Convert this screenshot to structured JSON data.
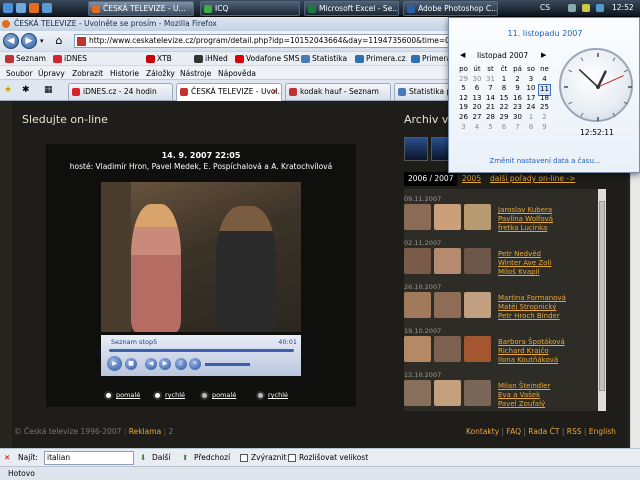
{
  "taskbar": {
    "buttons": [
      {
        "label": "ČESKÁ TELEVIZE - U...",
        "active": true
      },
      {
        "label": "ICQ",
        "active": false
      },
      {
        "label": "Microsoft Excel - Se...",
        "active": false
      },
      {
        "label": "Adobe Photoshop C...",
        "active": false
      }
    ],
    "language": "CS",
    "clock": "12:52"
  },
  "browser": {
    "window_title": "ČESKÁ TELEVIZE - Uvolněte se prosím - Mozilla Firefox",
    "url": "http://www.ceskatelevize.cz/program/detail.php?idp=10152043664&day=1194735600&time=01:50&ch=28",
    "bookmarks": [
      "Seznam",
      "iDNES",
      "XTB",
      "iHNed",
      "Vodafone SMS",
      "Statistika",
      "Primera.cz",
      "Primera"
    ],
    "menu": [
      "Soubor",
      "Úpravy",
      "Zobrazit",
      "Historie",
      "Záložky",
      "Nástroje",
      "Nápověda"
    ],
    "tabs": [
      {
        "label": "iDNES.cz - 24 hodin",
        "active": false
      },
      {
        "label": "ČESKÁ TELEVIZE - Uvol...",
        "active": true
      },
      {
        "label": "kodak hauf - Seznam",
        "active": false
      },
      {
        "label": "Statistika p",
        "active": false
      }
    ]
  },
  "page": {
    "live_title": "Sledujte on-line",
    "player": {
      "date": "14. 9. 2007 22:05",
      "guests": "hosté: Vladimír Hron, Pavel Medek, E. Pospíchalová a A. Kratochvílová",
      "media_title": "Seznam stop5",
      "media_time": "40:01",
      "quality_options": [
        {
          "label": "pomalé",
          "type": "wmp"
        },
        {
          "label": "rychlé",
          "type": "wmp"
        },
        {
          "label": "pomalé",
          "type": "real"
        },
        {
          "label": "rychlé",
          "type": "real"
        }
      ],
      "real_prefix": "real"
    },
    "archive": {
      "title": "Archiv v",
      "tabs": [
        "2006 / 2007",
        "2005",
        "další pořady on-line ->"
      ],
      "entries": [
        {
          "date": "09.11.2007",
          "names": [
            "Jaroslav Kubera",
            "Pavlína Wolfová",
            "fretka Lucinka"
          ]
        },
        {
          "date": "02.11.2007",
          "names": [
            "Petr Nedvěd",
            "Winter Ave Zoli",
            "Miloš Kvapil"
          ]
        },
        {
          "date": "26.10.2007",
          "names": [
            "Martina Formanová",
            "Matěj Stropnický",
            "Petr Hroch Binder"
          ]
        },
        {
          "date": "19.10.2007",
          "names": [
            "Barbora Špotáková",
            "Richard Krajčo",
            "Ilona Koutňáková"
          ]
        },
        {
          "date": "12.10.2007",
          "names": [
            "Milan Šteindler",
            "Eva a Vašek",
            "Pavel Zoufalý"
          ]
        }
      ]
    },
    "footer": {
      "copyright": "© Česká televize 1996-2007",
      "reklama": "Reklama",
      "page_num": "2",
      "links": [
        "Kontakty",
        "FAQ",
        "Rada ČT",
        "RSS",
        "English"
      ]
    }
  },
  "findbar": {
    "label": "Najít:",
    "value": "italian",
    "next": "Další",
    "prev": "Předchozí",
    "highlight": "Zvýraznit",
    "match_case": "Rozlišovat velikost"
  },
  "status": "Hotovo",
  "calendar": {
    "long_date": "11. listopadu 2007",
    "month": "listopad 2007",
    "weekdays": [
      "po",
      "út",
      "st",
      "čt",
      "pá",
      "so",
      "ne"
    ],
    "weeks": [
      [
        "29",
        "30",
        "31",
        "1",
        "2",
        "3",
        "4"
      ],
      [
        "5",
        "6",
        "7",
        "8",
        "9",
        "10",
        "11"
      ],
      [
        "12",
        "13",
        "14",
        "15",
        "16",
        "17",
        "18"
      ],
      [
        "19",
        "20",
        "21",
        "22",
        "23",
        "24",
        "25"
      ],
      [
        "26",
        "27",
        "28",
        "29",
        "30",
        "1",
        "2"
      ],
      [
        "3",
        "4",
        "5",
        "6",
        "7",
        "8",
        "9"
      ]
    ],
    "today": "11",
    "clock_time": "12:52:11",
    "clock_hands": {
      "hour": 12,
      "minute": 52,
      "second": 11
    },
    "settings_link": "Změnit nastavení data a času..."
  },
  "colors": {
    "accent_orange": "#e9a83a",
    "link_blue": "#1f5fbf"
  }
}
